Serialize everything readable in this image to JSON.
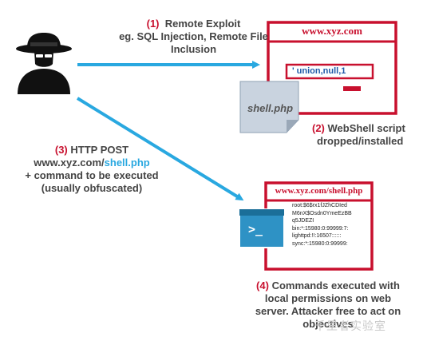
{
  "step1": {
    "number": "(1)",
    "title": "Remote Exploit",
    "line2": "eg. SQL Injection, Remote File",
    "line3": "Inclusion"
  },
  "browser1": {
    "url": "www.xyz.com",
    "payload": "' union,null,1"
  },
  "shell_file": {
    "label": "shell.php"
  },
  "step2": {
    "number": "(2)",
    "line1": "WebShell script",
    "line2": "dropped/installed"
  },
  "step3": {
    "number": "(3)",
    "line1": "HTTP POST",
    "url_prefix": "www.xyz.com/",
    "url_highlight": "shell.php",
    "line3": "+ command to be executed",
    "line4": "(usually obfuscated)"
  },
  "browser2": {
    "url": "www.xyz.com/shell.php",
    "output_lines": [
      "root:$6$rx1fJZhCDIed",
      "M6nX$Osdn0YmeEzBB",
      "q5JDEZI",
      "bin:*:15980:0:99999:7:",
      "lighttpd:!!:16507::::::",
      "sync:*:15980:0:99999:"
    ]
  },
  "terminal": {
    "prompt": ">_"
  },
  "step4": {
    "number": "(4)",
    "line1": "Commands executed with",
    "line2": "local permissions on web",
    "line3": "server. Attacker free to act on",
    "line4": "objectives"
  },
  "watermark": {
    "text": "千里者实验室"
  },
  "colors": {
    "arrow": "#29a8e0",
    "accent_red": "#c8102e",
    "hacker": "#111111",
    "file": "#c9d3df"
  }
}
